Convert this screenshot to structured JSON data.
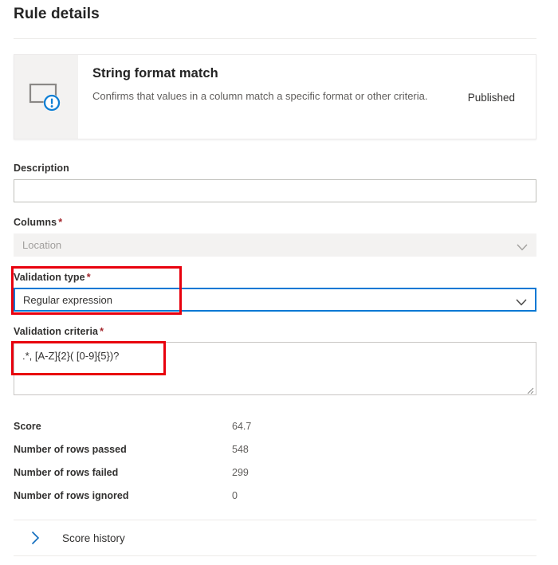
{
  "header": {
    "title": "Rule details"
  },
  "rule_card": {
    "icon": "screen-alert-icon",
    "name": "String format match",
    "description": "Confirms that values in a column match a specific format or other criteria.",
    "status": "Published"
  },
  "form": {
    "description": {
      "label": "Description",
      "value": "",
      "placeholder": ""
    },
    "columns": {
      "label": "Columns",
      "required_marker": "*",
      "value": "Location",
      "disabled": true,
      "chevron": "chevron-down-icon"
    },
    "validation_type": {
      "label": "Validation type",
      "required_marker": "*",
      "value": "Regular expression",
      "focused": true,
      "chevron": "chevron-down-icon"
    },
    "validation_criteria": {
      "label": "Validation criteria",
      "required_marker": "*",
      "value": ".*, [A-Z]{2}( [0-9]{5})?"
    }
  },
  "stats": {
    "rows": [
      {
        "label": "Score",
        "value": "64.7"
      },
      {
        "label": "Number of rows passed",
        "value": "548"
      },
      {
        "label": "Number of rows failed",
        "value": "299"
      },
      {
        "label": "Number of rows ignored",
        "value": "0"
      }
    ]
  },
  "score_history": {
    "label": "Score history",
    "expand_icon": "chevron-right-icon",
    "expanded": false
  },
  "annotations": [
    {
      "name": "validation-type-highlight"
    },
    {
      "name": "validation-criteria-highlight"
    }
  ],
  "colors": {
    "accent": "#0078d4",
    "required": "#a4262c",
    "annotation": "#e8000d",
    "panel": "#f3f2f1"
  }
}
